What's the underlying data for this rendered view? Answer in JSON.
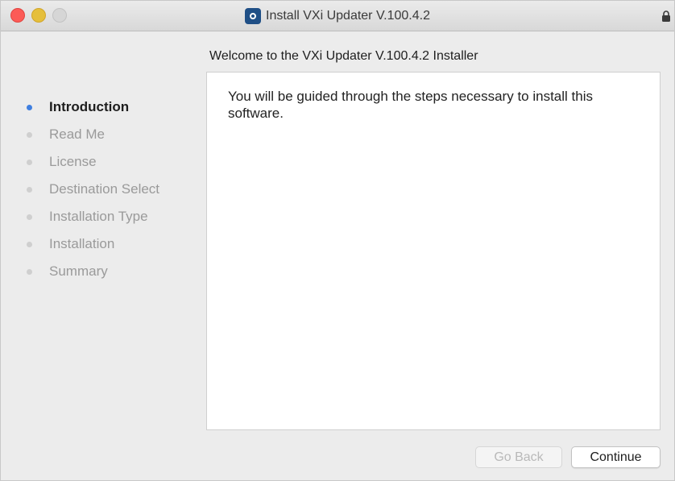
{
  "window": {
    "title": "Install VXi Updater V.100.4.2",
    "app_icon": "installer-package-icon",
    "lock_icon": "lock-icon"
  },
  "header": {
    "welcome": "Welcome to the VXi Updater V.100.4.2 Installer"
  },
  "sidebar": {
    "active_color": "#3f7fe0",
    "items": [
      {
        "label": "Introduction",
        "active": true
      },
      {
        "label": "Read Me",
        "active": false
      },
      {
        "label": "License",
        "active": false
      },
      {
        "label": "Destination Select",
        "active": false
      },
      {
        "label": "Installation Type",
        "active": false
      },
      {
        "label": "Installation",
        "active": false
      },
      {
        "label": "Summary",
        "active": false
      }
    ]
  },
  "main": {
    "body_text": "You will be guided through the steps necessary to install this software."
  },
  "buttons": {
    "back_label": "Go Back",
    "back_enabled": false,
    "continue_label": "Continue"
  }
}
